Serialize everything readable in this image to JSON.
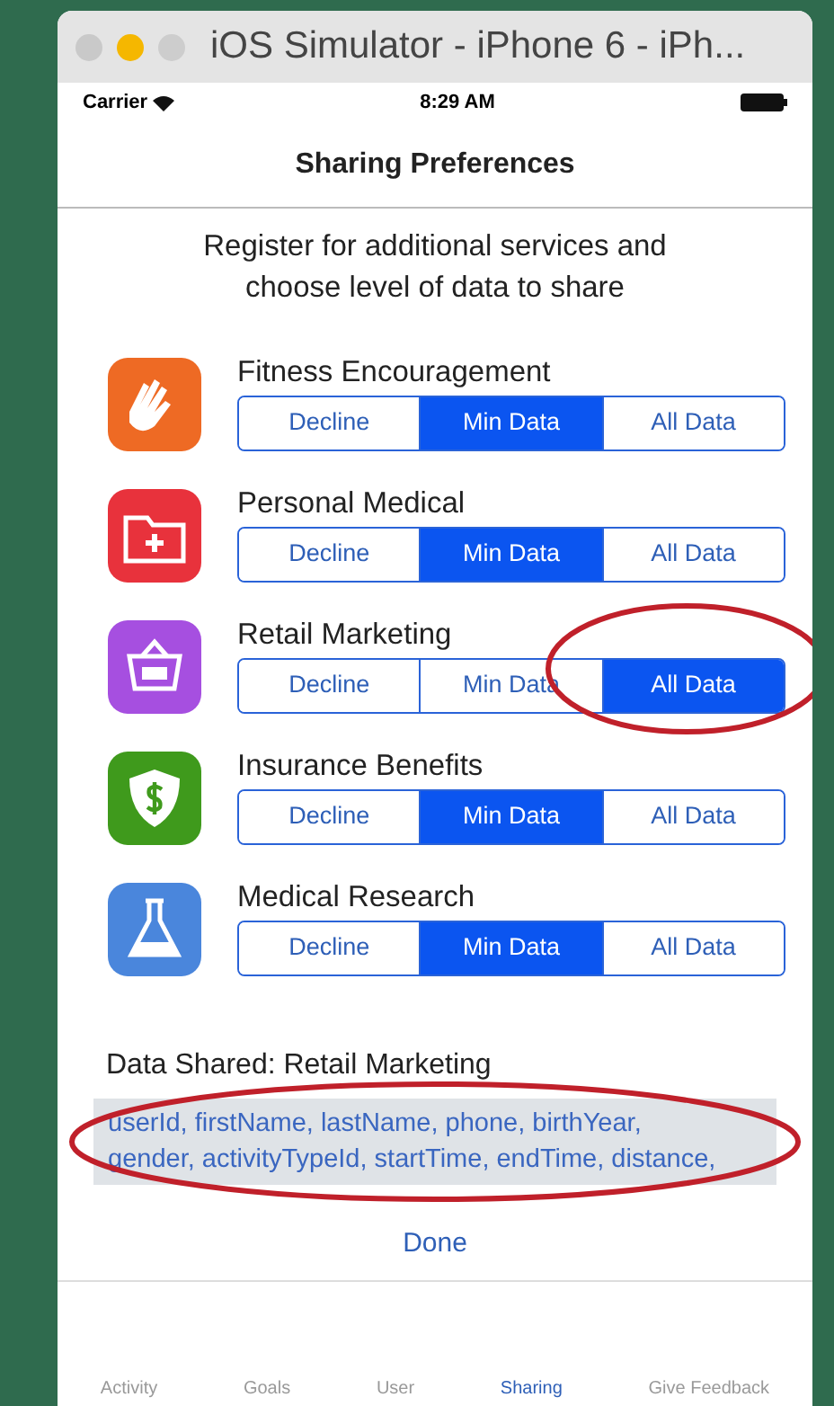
{
  "window": {
    "title": "iOS Simulator - iPhone 6 - iPh..."
  },
  "status_bar": {
    "carrier": "Carrier",
    "time": "8:29 AM"
  },
  "nav": {
    "title": "Sharing Preferences"
  },
  "intro": "Register for additional services and choose level of data to share",
  "services": [
    {
      "name": "Fitness Encouragement",
      "color": "#ee6a24",
      "options": [
        {
          "label": "Decline",
          "selected": false
        },
        {
          "label": "Min Data",
          "selected": true
        },
        {
          "label": "All Data",
          "selected": false
        }
      ]
    },
    {
      "name": "Personal Medical",
      "color": "#e8323c",
      "options": [
        {
          "label": "Decline",
          "selected": false
        },
        {
          "label": "Min Data",
          "selected": true
        },
        {
          "label": "All Data",
          "selected": false
        }
      ]
    },
    {
      "name": "Retail Marketing",
      "color": "#a64fe0",
      "options": [
        {
          "label": "Decline",
          "selected": false
        },
        {
          "label": "Min Data",
          "selected": false
        },
        {
          "label": "All Data",
          "selected": true
        }
      ]
    },
    {
      "name": "Insurance Benefits",
      "color": "#3f9a1c",
      "options": [
        {
          "label": "Decline",
          "selected": false
        },
        {
          "label": "Min Data",
          "selected": true
        },
        {
          "label": "All Data",
          "selected": false
        }
      ]
    },
    {
      "name": "Medical Research",
      "color": "#4a86dc",
      "options": [
        {
          "label": "Decline",
          "selected": false
        },
        {
          "label": "Min Data",
          "selected": true
        },
        {
          "label": "All Data",
          "selected": false
        }
      ]
    }
  ],
  "data_shared": {
    "title": "Data Shared: Retail Marketing",
    "field_lines": [
      "userId, firstName, lastName, phone, birthYear,",
      "gender, activityTypeId, startTime, endTime, distance,"
    ]
  },
  "done_button": "Done",
  "tabs": [
    {
      "label": "Activity",
      "selected": false
    },
    {
      "label": "Goals",
      "selected": false
    },
    {
      "label": "User",
      "selected": false
    },
    {
      "label": "Sharing",
      "selected": true
    },
    {
      "label": "Give Feedback",
      "selected": false
    }
  ]
}
